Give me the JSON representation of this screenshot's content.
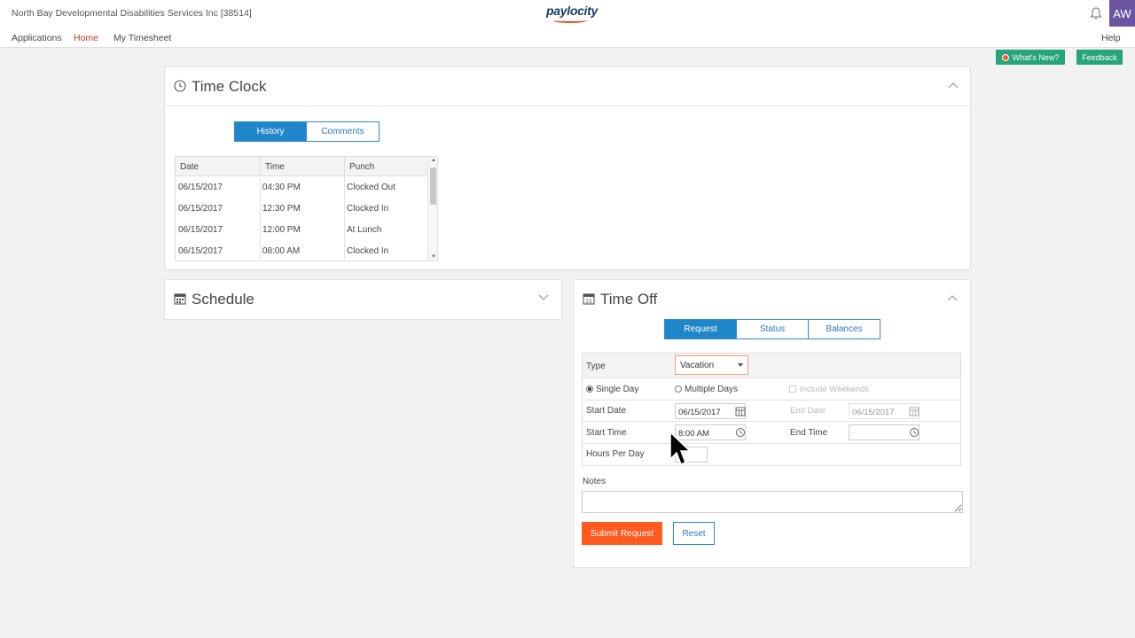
{
  "header": {
    "company": "North Bay Developmental Disabilities Services Inc [38514]",
    "logo_text": "paylocity",
    "avatar_initials": "AW"
  },
  "nav": {
    "applications": "Applications",
    "home": "Home",
    "timesheet": "My Timesheet",
    "help": "Help"
  },
  "actions": {
    "whats_new": "What's New?",
    "feedback": "Feedback"
  },
  "time_clock": {
    "title": "Time Clock",
    "tabs": [
      "History",
      "Comments"
    ],
    "columns": [
      "Date",
      "Time",
      "Punch"
    ],
    "rows": [
      {
        "date": "06/15/2017",
        "time": "04:30 PM",
        "punch": "Clocked Out"
      },
      {
        "date": "06/15/2017",
        "time": "12:30 PM",
        "punch": "Clocked In"
      },
      {
        "date": "06/15/2017",
        "time": "12:00 PM",
        "punch": "At Lunch"
      },
      {
        "date": "06/15/2017",
        "time": "08:00 AM",
        "punch": "Clocked In"
      }
    ]
  },
  "schedule": {
    "title": "Schedule"
  },
  "time_off": {
    "title": "Time Off",
    "tabs": [
      "Request",
      "Status",
      "Balances"
    ],
    "type_label": "Type",
    "type_value": "Vacation",
    "single_day": "Single Day",
    "multiple_days": "Multiple Days",
    "include_weekends": "Include Weekends",
    "start_date_label": "Start Date",
    "start_date_value": "06/15/2017",
    "end_date_label": "End Date",
    "end_date_value": "06/15/2017",
    "start_time_label": "Start Time",
    "start_time_value": "8:00 AM",
    "end_time_label": "End Time",
    "hours_per_day_label": "Hours Per Day",
    "notes_label": "Notes",
    "submit_label": "Submit Request",
    "reset_label": "Reset"
  },
  "colors": {
    "primary_blue": "#1f86c9",
    "accent_orange": "#ff5a1f",
    "green": "#27a47a",
    "avatar_purple": "#6b55a3"
  }
}
